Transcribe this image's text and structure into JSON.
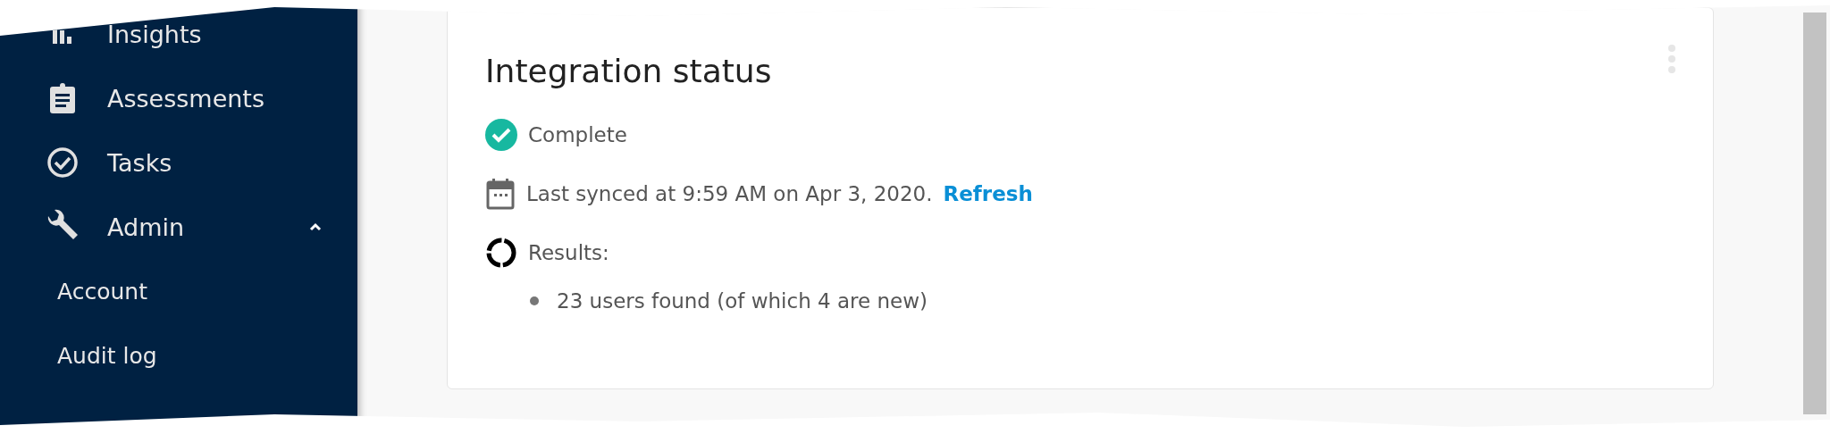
{
  "sidebar": {
    "items": [
      {
        "label": "Insights"
      },
      {
        "label": "Assessments"
      },
      {
        "label": "Tasks"
      },
      {
        "label": "Admin",
        "expanded": true,
        "children": [
          {
            "label": "Account"
          },
          {
            "label": "Audit log"
          }
        ]
      }
    ]
  },
  "card": {
    "title": "Integration status",
    "status": "Complete",
    "sync_text": "Last synced at 9:59 AM on Apr 3, 2020.",
    "refresh_link": "Refresh",
    "results_label": "Results:",
    "results": [
      "23 users found (of which 4 are new)"
    ]
  }
}
